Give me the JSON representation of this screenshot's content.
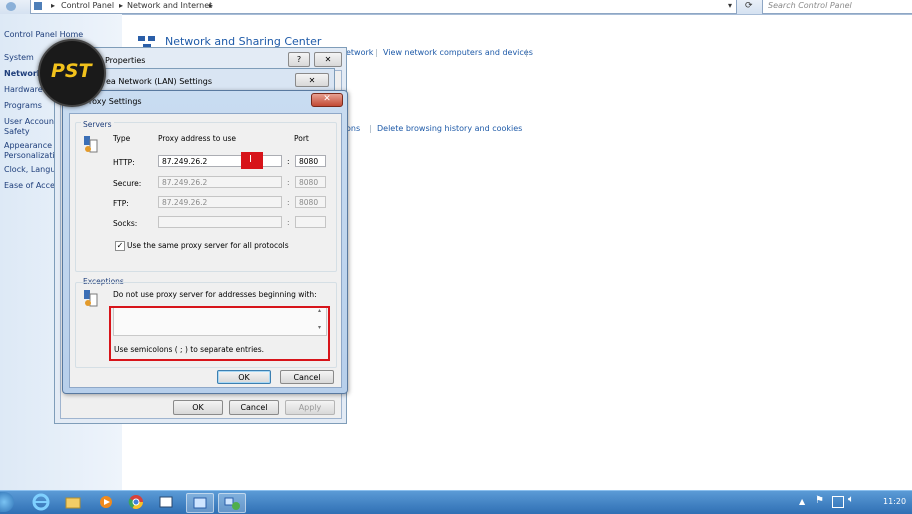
{
  "address_bar": {
    "crumbs": [
      "Control Panel",
      "Network and Internet"
    ],
    "search_placeholder": "Search Control Panel"
  },
  "left_pane": {
    "items": [
      "Control Panel Home",
      "System",
      "Network",
      "Hardware",
      "Programs",
      "User Account",
      "Safety",
      "Appearance a",
      "Personalizati",
      "Clock, Langu",
      "Ease of Acces"
    ]
  },
  "main": {
    "title": "Network and Sharing Center",
    "link_network_partial": "etwork",
    "link_view_computers": "View network computers and devices",
    "link_options_partial": "ons",
    "link_delete_history": "Delete browsing history and cookies"
  },
  "internet_properties": {
    "title_partial": "Properties",
    "help": "?",
    "close": "✕",
    "buttons": {
      "ok": "OK",
      "cancel": "Cancel",
      "apply": "Apply"
    }
  },
  "lan_settings": {
    "title_partial": "ea Network (LAN) Settings",
    "close": "✕"
  },
  "proxy_dialog": {
    "title": "roxy Settings",
    "close": "✕",
    "servers_label": "Servers",
    "col_type": "Type",
    "col_address": "Proxy address to use",
    "col_port": "Port",
    "rows": [
      {
        "type": "HTTP:",
        "address": "87.249.26.2",
        "port": "8080",
        "enabled": true
      },
      {
        "type": "Secure:",
        "address": "87.249.26.2",
        "port": "8080",
        "enabled": false
      },
      {
        "type": "FTP:",
        "address": "87.249.26.2",
        "port": "8080",
        "enabled": false
      },
      {
        "type": "Socks:",
        "address": "",
        "port": "",
        "enabled": false
      }
    ],
    "same_proxy_label": "Use the same proxy server for all protocols",
    "same_proxy_checked": true,
    "exceptions_label": "Exceptions",
    "exceptions_desc": "Do not use proxy server for addresses beginning with:",
    "exceptions_value": "",
    "exceptions_hint": "Use semicolons ( ; ) to separate entries.",
    "ok": "OK",
    "cancel": "Cancel",
    "highlight_color": "#d7141a"
  },
  "overlay_logo": {
    "text": "PST"
  },
  "taskbar": {
    "clock": "11:20"
  },
  "colors": {
    "accent": "#1e5aa8",
    "taskbar": "#3a7cc0",
    "highlight": "#d7141a"
  }
}
